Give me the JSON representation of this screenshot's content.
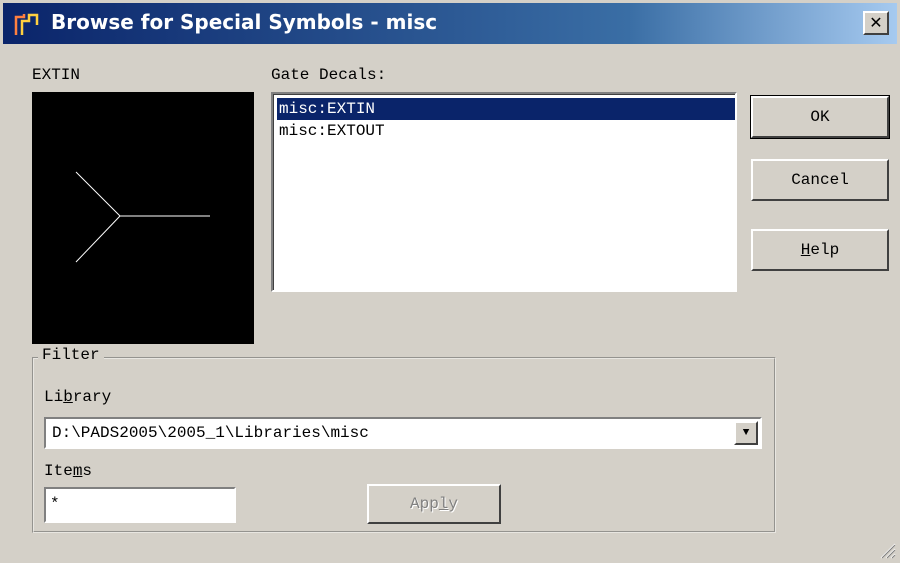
{
  "window": {
    "title": "Browse for Special Symbols - misc",
    "close_label": "✕"
  },
  "preview": {
    "label": "EXTIN"
  },
  "gate_decals": {
    "label": "Gate Decals:",
    "items": [
      "misc:EXTIN",
      "misc:EXTOUT"
    ],
    "selected_index": 0
  },
  "buttons": {
    "ok": "OK",
    "cancel": "Cancel",
    "help_mnemonic": "H",
    "help_rest": "elp"
  },
  "filter": {
    "title": "Filter",
    "library_label_pre": "Li",
    "library_label_mnemonic": "b",
    "library_label_post": "rary",
    "library_value": "D:\\PADS2005\\2005_1\\Libraries\\misc",
    "items_label_pre": "Ite",
    "items_label_mnemonic": "m",
    "items_label_post": "s",
    "items_value": "*",
    "apply_pre": "App",
    "apply_mnemonic": "l",
    "apply_post": "y"
  },
  "colors": {
    "title_bar": "#0a246a",
    "selection": "#0a246a",
    "dialog_bg": "#d4d0c8"
  }
}
